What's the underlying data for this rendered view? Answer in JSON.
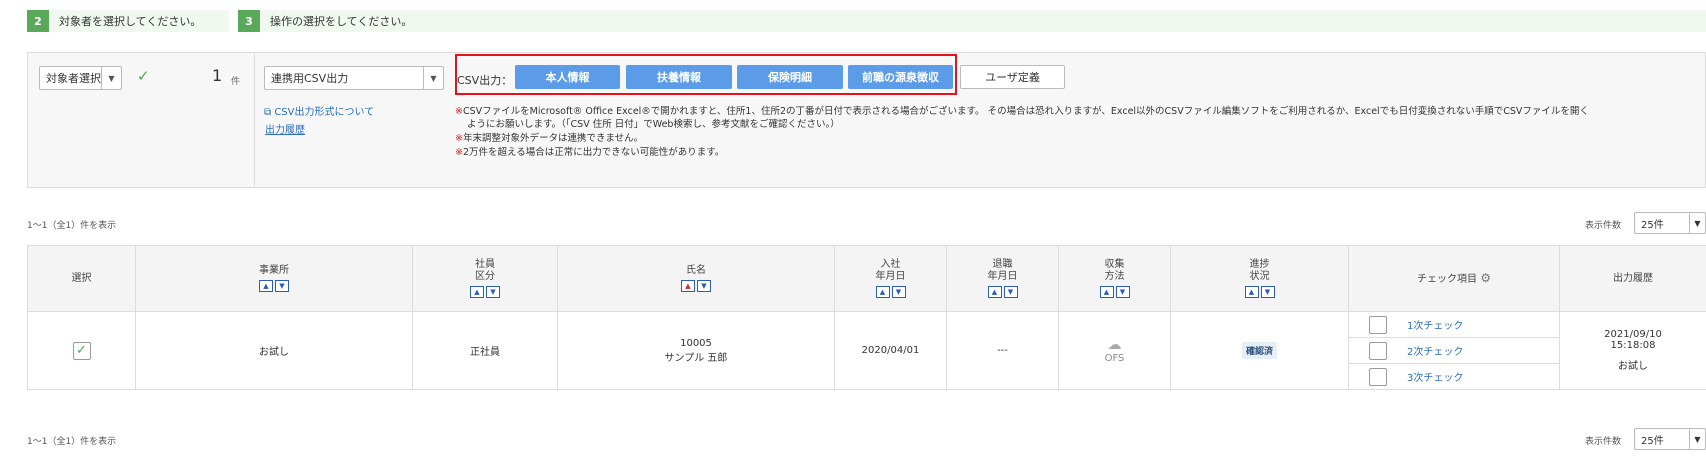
{
  "steps": [
    {
      "num": "2",
      "text": "対象者を選択してください。"
    },
    {
      "num": "3",
      "text": "操作の選択をしてください。"
    }
  ],
  "target": {
    "select_value": "対象者選択",
    "count": "1",
    "count_unit": "件"
  },
  "operation": {
    "select_value": "連携用CSV出力",
    "format_link": "CSV出力形式について",
    "history_link": "出力履歴",
    "csv_label": "CSV出力：",
    "buttons": [
      "本人情報",
      "扶養情報",
      "保険明細",
      "前職の源泉徴収"
    ],
    "user_def_button": "ユーザ定義",
    "notes": [
      "CSVファイルをMicrosoft® Office Excel®で開かれますと、住所1、住所2の丁番が日付で表示される場合がございます。 その場合は恐れ入りますが、Excel以外のCSVファイル編集ソフトをご利用されるか、Excelでも日付変換されない手順でCSVファイルを開く",
      "ようにお願いします。（「CSV 住所 日付」でWeb検索し、参考文献をご確認ください。）",
      "年末調整対象外データは連携できません。",
      "2万件を超える場合は正常に出力できない可能性があります。"
    ]
  },
  "list_info_top": "1〜1（全1）件を表示",
  "list_info_bottom": "1〜1（全1）件を表示",
  "pager": {
    "label": "表示件数",
    "value": "25件"
  },
  "table": {
    "headers": {
      "select": "選択",
      "office": "事業所",
      "emp_type_1": "社員",
      "emp_type_2": "区分",
      "name": "氏名",
      "join_1": "入社",
      "join_2": "年月日",
      "leave_1": "退職",
      "leave_2": "年月日",
      "collect_1": "収集",
      "collect_2": "方法",
      "progress_1": "進捗",
      "progress_2": "状況",
      "check_items": "チェック項目",
      "history": "出力履歴"
    },
    "row": {
      "office": "お試し",
      "emp_type": "正社員",
      "emp_no": "10005",
      "name": "サンプル 五郎",
      "join_date": "2020/04/01",
      "leave_date": "---",
      "collect": "OFS",
      "status": "確認済",
      "checks": [
        "1次チェック",
        "2次チェック",
        "3次チェック"
      ],
      "history_date": "2021/09/10",
      "history_time": "15:18:08",
      "history_user": "お試し"
    }
  }
}
